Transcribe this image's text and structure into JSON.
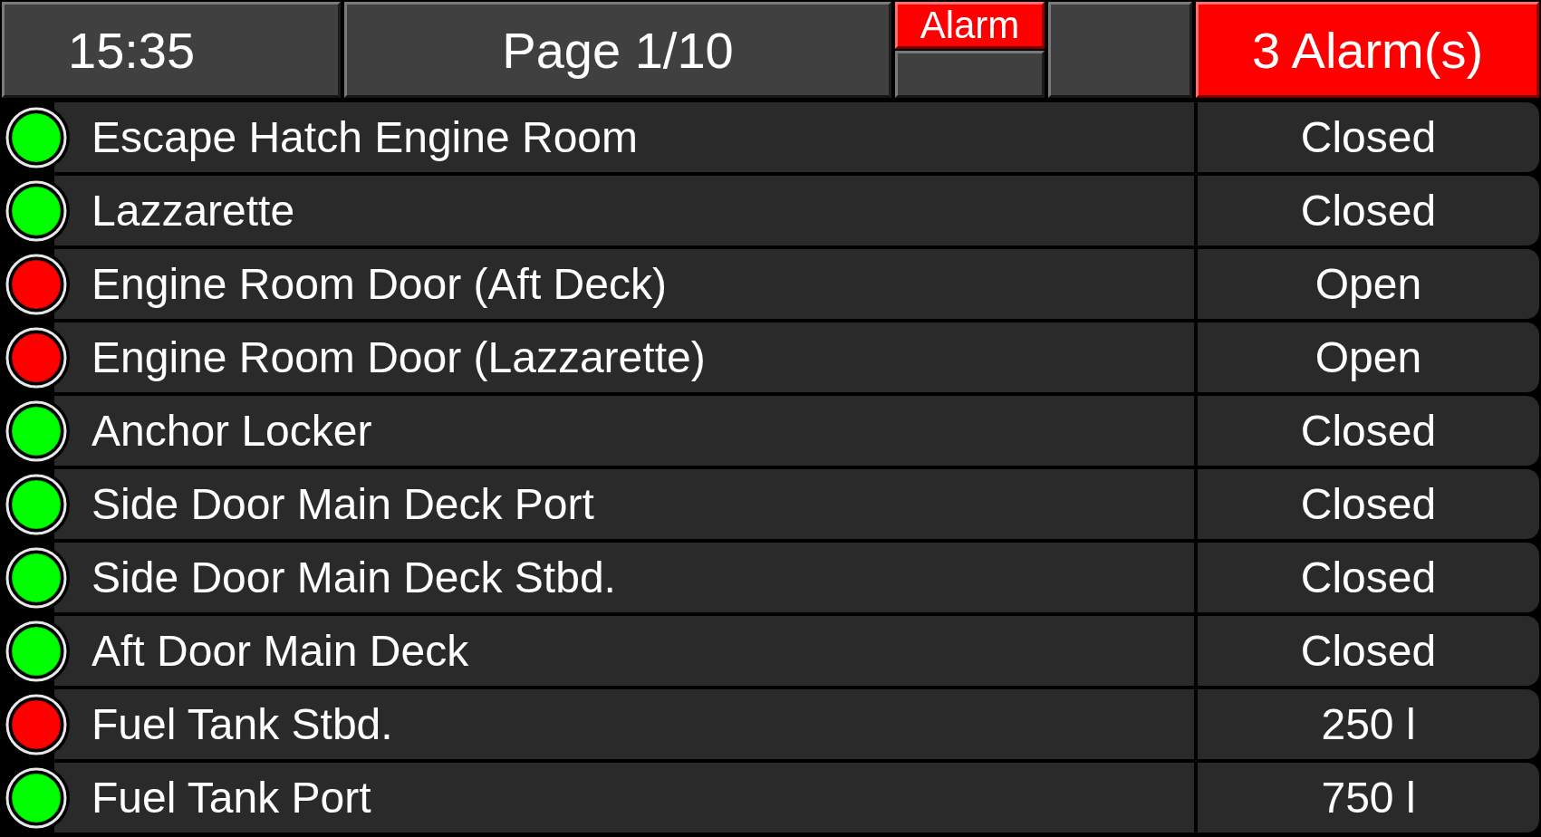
{
  "header": {
    "time": "15:35",
    "page": "Page 1/10",
    "alarm_button": {
      "label": "Alarm",
      "active": true
    },
    "alarm_count": {
      "label": "3 Alarm(s)",
      "active": true
    }
  },
  "rows": [
    {
      "name": "Escape Hatch Engine Room",
      "color": "#00ff00",
      "value": "Closed"
    },
    {
      "name": "Lazzarette",
      "color": "#00ff00",
      "value": "Closed"
    },
    {
      "name": "Engine Room Door (Aft Deck)",
      "color": "#ff0000",
      "value": "Open"
    },
    {
      "name": "Engine Room Door (Lazzarette)",
      "color": "#ff0000",
      "value": "Open"
    },
    {
      "name": "Anchor Locker",
      "color": "#00ff00",
      "value": "Closed"
    },
    {
      "name": "Side Door Main Deck Port",
      "color": "#00ff00",
      "value": "Closed"
    },
    {
      "name": "Side Door Main Deck Stbd.",
      "color": "#00ff00",
      "value": "Closed"
    },
    {
      "name": "Aft Door Main Deck",
      "color": "#00ff00",
      "value": "Closed"
    },
    {
      "name": "Fuel Tank Stbd.",
      "color": "#ff0000",
      "value": "250 l"
    },
    {
      "name": "Fuel Tank Port",
      "color": "#00ff00",
      "value": "750 l"
    }
  ]
}
